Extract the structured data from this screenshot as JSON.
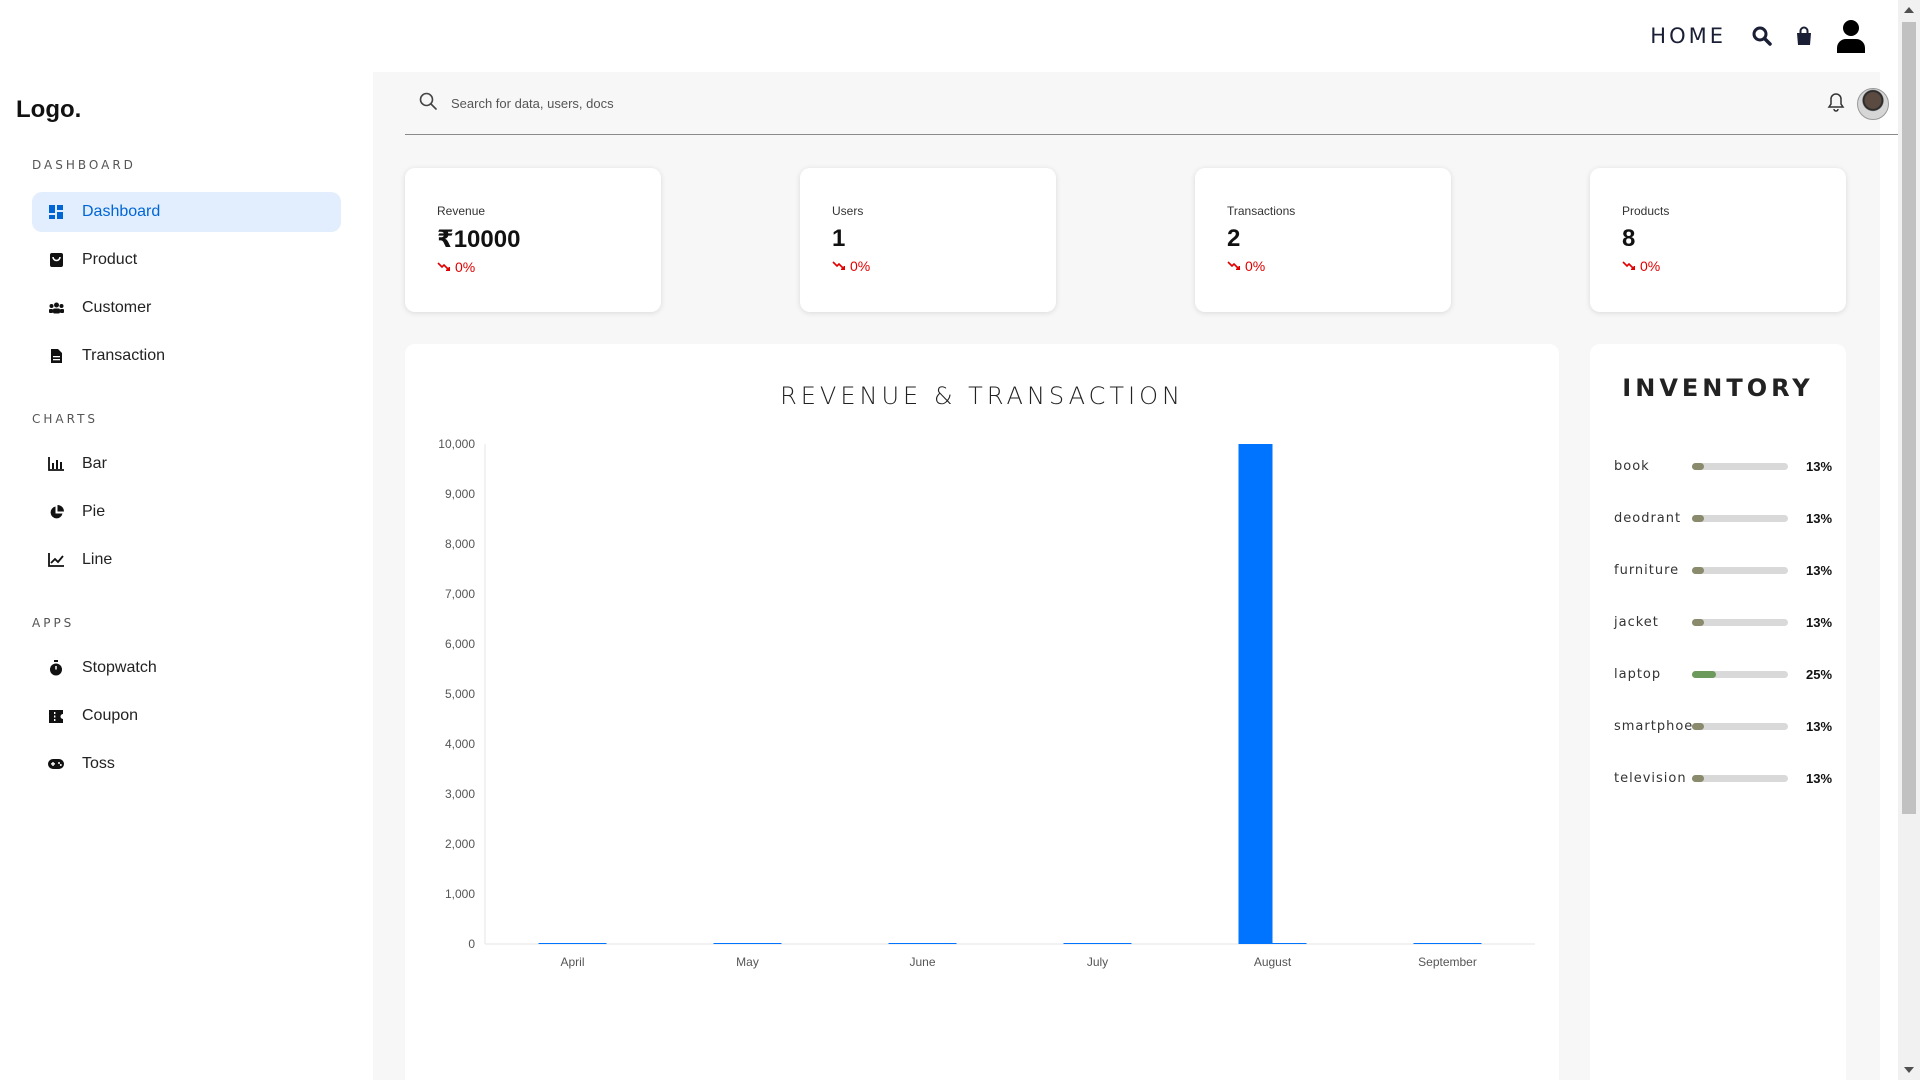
{
  "topnav": {
    "home_label": "HOME"
  },
  "sidebar": {
    "logo": "Logo.",
    "sections": [
      {
        "title": "DASHBOARD",
        "items": [
          {
            "label": "Dashboard",
            "icon": "dashboard-icon",
            "active": true
          },
          {
            "label": "Product",
            "icon": "bag-icon"
          },
          {
            "label": "Customer",
            "icon": "people-icon"
          },
          {
            "label": "Transaction",
            "icon": "document-icon"
          }
        ]
      },
      {
        "title": "CHARTS",
        "items": [
          {
            "label": "Bar",
            "icon": "bar-chart-icon"
          },
          {
            "label": "Pie",
            "icon": "pie-chart-icon"
          },
          {
            "label": "Line",
            "icon": "line-chart-icon"
          }
        ]
      },
      {
        "title": "APPS",
        "items": [
          {
            "label": "Stopwatch",
            "icon": "stopwatch-icon"
          },
          {
            "label": "Coupon",
            "icon": "coupon-icon"
          },
          {
            "label": "Toss",
            "icon": "gamepad-icon"
          }
        ]
      }
    ]
  },
  "search": {
    "placeholder": "Search for data, users, docs"
  },
  "cards": [
    {
      "label": "Revenue",
      "value": "₹10000",
      "change": "0%"
    },
    {
      "label": "Users",
      "value": "1",
      "change": "0%"
    },
    {
      "label": "Transactions",
      "value": "2",
      "change": "0%"
    },
    {
      "label": "Products",
      "value": "8",
      "change": "0%"
    }
  ],
  "colors": {
    "accent": "#0073ff",
    "negative": "#e00000",
    "active_bg": "#e2eefd"
  },
  "chart_data": {
    "type": "bar",
    "title": "REVENUE & TRANSACTION",
    "categories": [
      "April",
      "May",
      "June",
      "July",
      "August",
      "September"
    ],
    "series": [
      {
        "values": [
          0,
          0,
          0,
          0,
          10000,
          0
        ],
        "color": "#0073ff"
      },
      {
        "values": [
          0,
          0,
          0,
          0,
          2,
          0
        ],
        "color": "#0073ff"
      }
    ],
    "ylim": [
      0,
      10000
    ],
    "yticks": [
      "0",
      "1,000",
      "2,000",
      "3,000",
      "4,000",
      "5,000",
      "6,000",
      "7,000",
      "8,000",
      "9,000",
      "10,000"
    ],
    "grid": false
  },
  "inventory": {
    "title": "INVENTORY",
    "items": [
      {
        "name": "book",
        "percent": 13,
        "label": "13%",
        "color": "#8a8a6c"
      },
      {
        "name": "deodrant",
        "percent": 13,
        "label": "13%",
        "color": "#8a8a6c"
      },
      {
        "name": "furniture",
        "percent": 13,
        "label": "13%",
        "color": "#8a8a6c"
      },
      {
        "name": "jacket",
        "percent": 13,
        "label": "13%",
        "color": "#8a8a6c"
      },
      {
        "name": "laptop",
        "percent": 25,
        "label": "25%",
        "color": "#6c9a5c"
      },
      {
        "name": "smartphoe",
        "percent": 13,
        "label": "13%",
        "color": "#8a8a6c"
      },
      {
        "name": "television",
        "percent": 13,
        "label": "13%",
        "color": "#8a8a6c"
      }
    ]
  }
}
